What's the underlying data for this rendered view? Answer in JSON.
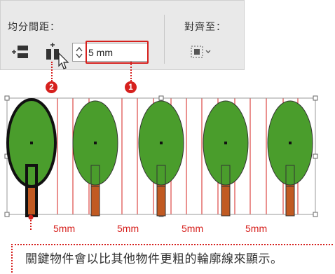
{
  "panel": {
    "distribute_spacing_label": "均分間距：",
    "align_to_label": "對齊至：",
    "spacing_value": "5 mm"
  },
  "callouts": {
    "badge_1": "1",
    "badge_2": "2"
  },
  "illustration": {
    "gap_labels": [
      "5mm",
      "5mm",
      "5mm",
      "5mm"
    ],
    "colors": {
      "leaf_green": "#4a9d2c",
      "trunk_brown": "#c15a22",
      "guide_red": "#d6201d",
      "panel_gray": "#e9e9e9"
    }
  },
  "note": {
    "text": "關鍵物件會以比其他物件更粗的輪廓線來顯示。"
  }
}
